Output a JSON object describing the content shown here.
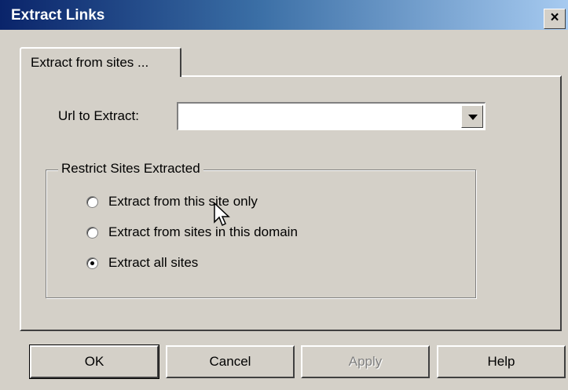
{
  "window": {
    "title": "Extract Links",
    "close_label": "×"
  },
  "tabs": [
    {
      "label": "Extract from sites ..."
    }
  ],
  "url_field": {
    "label": "Url to Extract:",
    "value": ""
  },
  "restrict_group": {
    "title": "Restrict Sites Extracted",
    "options": [
      {
        "label": "Extract from this site only",
        "checked": false
      },
      {
        "label": "Extract from sites in this domain",
        "checked": false
      },
      {
        "label": "Extract all sites",
        "checked": true
      }
    ]
  },
  "buttons": {
    "ok": "OK",
    "cancel": "Cancel",
    "apply": "Apply",
    "help": "Help"
  }
}
